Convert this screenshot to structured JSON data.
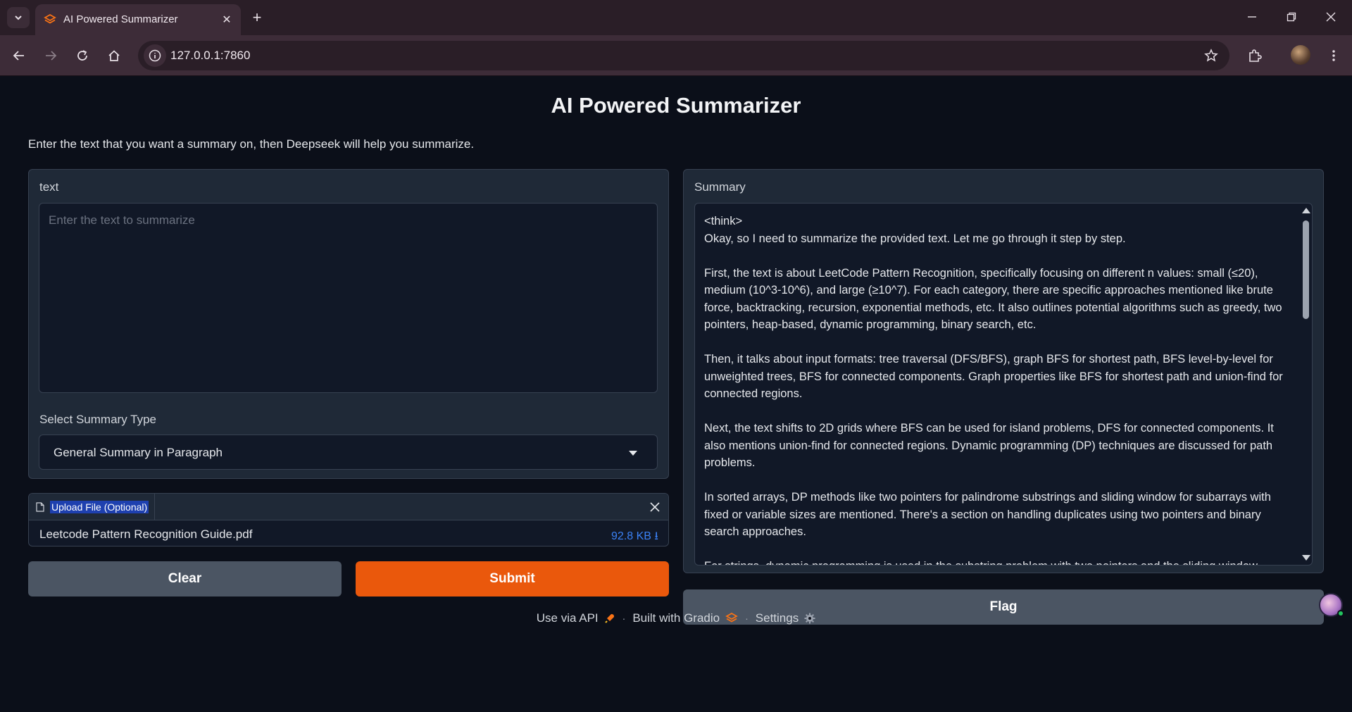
{
  "browser": {
    "tab_title": "AI Powered Summarizer",
    "url": "127.0.0.1:7860"
  },
  "app": {
    "title": "AI Powered Summarizer",
    "description": "Enter the text that you want a summary on, then Deepseek will help you summarize."
  },
  "input": {
    "label": "text",
    "placeholder": "Enter the text to summarize",
    "value": ""
  },
  "summary_type": {
    "label": "Select Summary Type",
    "selected": "General Summary in Paragraph"
  },
  "upload": {
    "label": "Upload File (Optional)",
    "file_name": "Leetcode Pattern Recognition Guide.pdf",
    "file_size": "92.8 KB ⭳"
  },
  "buttons": {
    "clear": "Clear",
    "submit": "Submit",
    "flag": "Flag"
  },
  "output": {
    "label": "Summary",
    "text": "<think>\nOkay, so I need to summarize the provided text. Let me go through it step by step.\n\nFirst, the text is about LeetCode Pattern Recognition, specifically focusing on different n values: small (≤20), medium (10^3-10^6), and large (≥10^7). For each category, there are specific approaches mentioned like brute force, backtracking, recursion, exponential methods, etc. It also outlines potential algorithms such as greedy, two pointers, heap-based, dynamic programming, binary search, etc.\n\nThen, it talks about input formats: tree traversal (DFS/BFS), graph BFS for shortest path, BFS level-by-level for unweighted trees, BFS for connected components. Graph properties like BFS for shortest path and union-find for connected regions.\n\nNext, the text shifts to 2D grids where BFS can be used for island problems, DFS for connected components. It also mentions union-find for connected regions. Dynamic programming (DP) techniques are discussed for path problems.\n\nIn sorted arrays, DP methods like two pointers for palindrome substrings and sliding window for subarrays with fixed or variable sizes are mentioned. There's a section on handling duplicates using two pointers and binary search approaches.\n\nFor strings, dynamic programming is used in the substring problem with two pointers and the sliding window"
  },
  "footer": {
    "api": "Use via API",
    "built": "Built with Gradio",
    "settings": "Settings",
    "separator": "·"
  },
  "colors": {
    "accent": "#ea580c",
    "background": "#0b0f19",
    "panel": "#1f2937",
    "secondary_button": "#4b5563",
    "link": "#3b82f6"
  }
}
